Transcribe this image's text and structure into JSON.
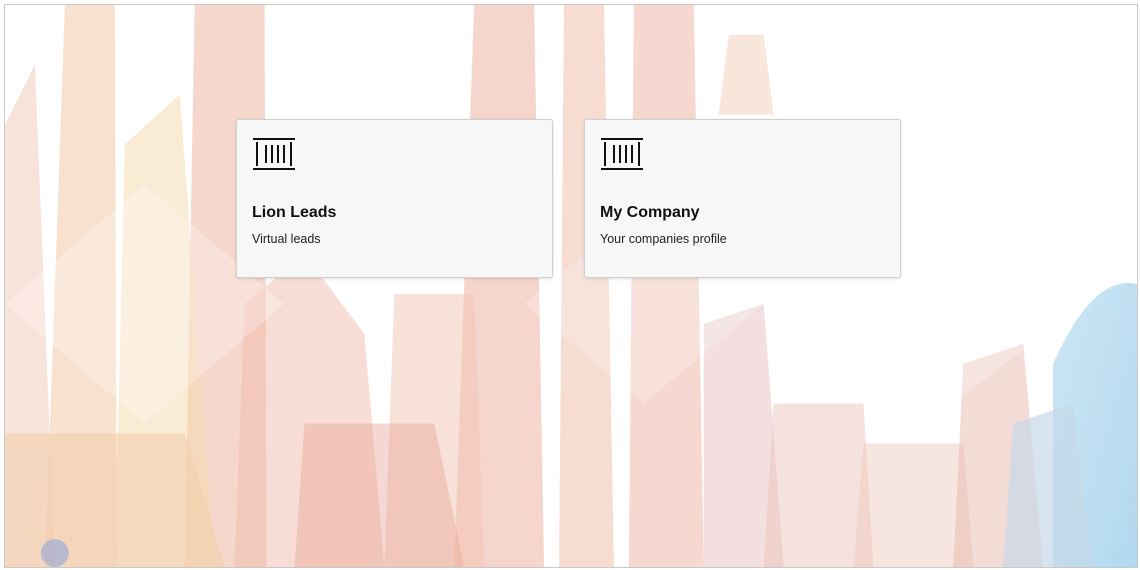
{
  "background": {
    "icon": "city-skyline-illustration"
  },
  "cards": [
    {
      "icon": "building-columns-icon",
      "title": "Lion Leads",
      "description": "Virtual leads"
    },
    {
      "icon": "building-columns-icon",
      "title": "My Company",
      "description": "Your companies profile"
    }
  ],
  "colors": {
    "card_background": "#f7f7f7",
    "card_border": "#cfcfcf",
    "text": "#111111"
  }
}
